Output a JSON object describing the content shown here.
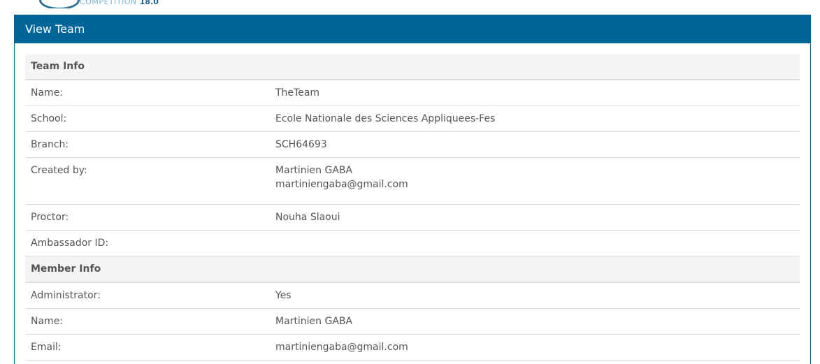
{
  "logo": {
    "text": "COMPETITION",
    "version": "18.0"
  },
  "panel": {
    "title": "View Team"
  },
  "team_info": {
    "heading": "Team Info",
    "rows": [
      {
        "label": "Name:",
        "value": "TheTeam"
      },
      {
        "label": "School:",
        "value": "Ecole Nationale des Sciences Appliquees-Fes"
      },
      {
        "label": "Branch:",
        "value": "SCH64693"
      },
      {
        "label": "Created by:",
        "value": "Martinien GABA",
        "value2": "martiniengaba@gmail.com"
      },
      {
        "label": "Proctor:",
        "value": "Nouha Slaoui"
      },
      {
        "label": "Ambassador ID:",
        "value": ""
      }
    ]
  },
  "member_info": {
    "heading": "Member Info",
    "rows": [
      {
        "label": "Administrator:",
        "value": "Yes"
      },
      {
        "label": "Name:",
        "value": "Martinien GABA"
      },
      {
        "label": "Email:",
        "value": "martiniengaba@gmail.com"
      }
    ]
  },
  "colors": {
    "primary": "#006699",
    "section_bg": "#f5f5f5",
    "border": "#dddddd",
    "text": "#555555"
  }
}
